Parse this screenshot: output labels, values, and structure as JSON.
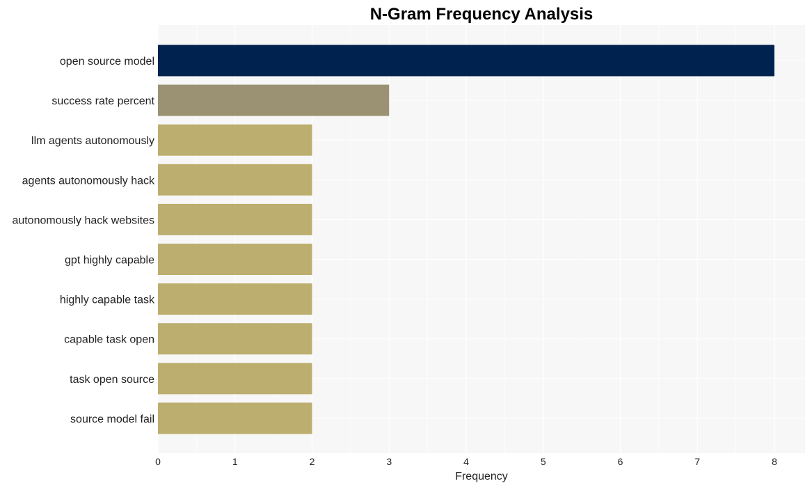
{
  "chart_data": {
    "type": "bar",
    "orientation": "horizontal",
    "title": "N-Gram Frequency Analysis",
    "xlabel": "Frequency",
    "ylabel": "",
    "categories": [
      "open source model",
      "success rate percent",
      "llm agents autonomously",
      "agents autonomously hack",
      "autonomously hack websites",
      "gpt highly capable",
      "highly capable task",
      "capable task open",
      "task open source",
      "source model fail"
    ],
    "values": [
      8,
      3,
      2,
      2,
      2,
      2,
      2,
      2,
      2,
      2
    ],
    "bar_colors": [
      "#00224e",
      "#9b9273",
      "#bcae6e",
      "#bcae6e",
      "#bcae6e",
      "#bcae6e",
      "#bcae6e",
      "#bcae6e",
      "#bcae6e",
      "#bcae6e"
    ],
    "xlim": [
      0,
      8.4
    ],
    "xticks": [
      0,
      1,
      2,
      3,
      4,
      5,
      6,
      7,
      8
    ],
    "grid": true,
    "panel_background": "#f7f7f7",
    "grid_color": "#ffffff",
    "legend": "none"
  }
}
